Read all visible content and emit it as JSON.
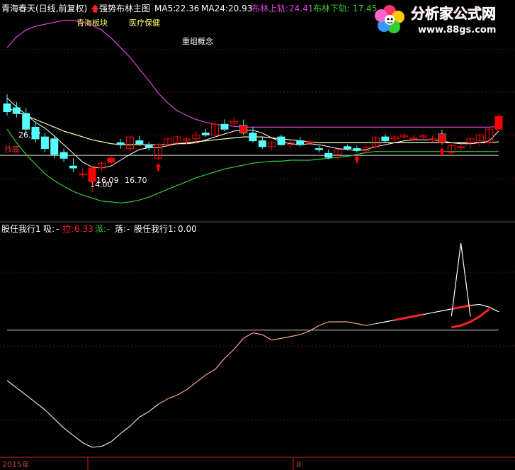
{
  "header": {
    "stock": "青海春天(日线,前复权)",
    "indicator": "强势布林主图",
    "ma5_label": "MA5:",
    "ma5_value": "22.36",
    "ma24_label": "MA24:",
    "ma24_value": "20.93",
    "upper_label": "布林上轨:",
    "upper_value": "24.41",
    "lower_label": "布林下轨:",
    "lower_value": "17.45"
  },
  "watermark": {
    "title": "分析家公式网",
    "url": "www.88gs.com"
  },
  "annotations": {
    "tag1": "青海板块",
    "tag2": "医疗保健",
    "tag3": "重组概念",
    "bottom_label": "抄底"
  },
  "price_labels": {
    "high": "26.97",
    "low": "14.00",
    "low_a": "16.09",
    "low_b": "16.70"
  },
  "lower_panel": {
    "name": "股任我行1",
    "xi_label": "吸:",
    "xi_value": "-",
    "la_label": "拉:",
    "la_value": "6.33",
    "pai_label": "派:",
    "pai_value": "-",
    "luo_label": "落:",
    "luo_value": "-",
    "value_label": "股任我行1:",
    "value": "0.00"
  },
  "axis": {
    "year": "2015年",
    "month": "8"
  },
  "colors": {
    "bg": "#000000",
    "up": "#ff0000",
    "down": "#55ffff",
    "upper": "#dd44dd",
    "lower": "#33cc33",
    "mid": "#ffffaa",
    "ma": "#ffffff",
    "arrow": "#ff0000",
    "la": "#ff2222"
  },
  "chart_data": {
    "type": "candlestick",
    "candles": [
      {
        "o": 25.2,
        "h": 26.2,
        "l": 24.0,
        "c": 24.4
      },
      {
        "o": 24.8,
        "h": 25.4,
        "l": 23.8,
        "c": 24.2
      },
      {
        "o": 24.2,
        "h": 24.8,
        "l": 22.0,
        "c": 22.6
      },
      {
        "o": 22.8,
        "h": 23.4,
        "l": 21.2,
        "c": 21.6
      },
      {
        "o": 21.8,
        "h": 22.2,
        "l": 20.2,
        "c": 20.6
      },
      {
        "o": 21.6,
        "h": 22.0,
        "l": 19.6,
        "c": 20.0
      },
      {
        "o": 20.2,
        "h": 20.6,
        "l": 19.2,
        "c": 19.6
      },
      {
        "o": 18.8,
        "h": 19.6,
        "l": 18.2,
        "c": 18.6
      },
      {
        "o": 18.0,
        "h": 18.6,
        "l": 17.6,
        "c": 18.0
      },
      {
        "o": 17.2,
        "h": 18.8,
        "l": 16.1,
        "c": 18.6
      },
      {
        "o": 18.6,
        "h": 19.3,
        "l": 18.2,
        "c": 19.1
      },
      {
        "o": 19.4,
        "h": 19.9,
        "l": 19.0,
        "c": 19.6
      },
      {
        "o": 21.2,
        "h": 21.6,
        "l": 20.6,
        "c": 21.0
      },
      {
        "o": 20.6,
        "h": 21.8,
        "l": 20.2,
        "c": 21.8
      },
      {
        "o": 21.4,
        "h": 21.9,
        "l": 20.9,
        "c": 21.1
      },
      {
        "o": 20.9,
        "h": 21.3,
        "l": 20.4,
        "c": 20.7
      },
      {
        "o": 19.6,
        "h": 21.2,
        "l": 19.4,
        "c": 21.0
      },
      {
        "o": 21.0,
        "h": 21.7,
        "l": 20.8,
        "c": 21.6
      },
      {
        "o": 21.2,
        "h": 21.9,
        "l": 20.9,
        "c": 21.8
      },
      {
        "o": 21.4,
        "h": 21.7,
        "l": 21.0,
        "c": 21.6
      },
      {
        "o": 21.6,
        "h": 22.4,
        "l": 21.1,
        "c": 22.0
      },
      {
        "o": 22.2,
        "h": 22.6,
        "l": 21.8,
        "c": 22.0
      },
      {
        "o": 22.0,
        "h": 23.2,
        "l": 21.8,
        "c": 23.1
      },
      {
        "o": 23.1,
        "h": 23.6,
        "l": 22.4,
        "c": 22.6
      },
      {
        "o": 23.2,
        "h": 23.8,
        "l": 22.8,
        "c": 23.4
      },
      {
        "o": 23.0,
        "h": 23.6,
        "l": 22.0,
        "c": 22.2
      },
      {
        "o": 22.2,
        "h": 22.8,
        "l": 21.2,
        "c": 21.4
      },
      {
        "o": 21.4,
        "h": 21.8,
        "l": 20.6,
        "c": 20.8
      },
      {
        "o": 20.8,
        "h": 21.4,
        "l": 20.4,
        "c": 21.2
      },
      {
        "o": 21.8,
        "h": 22.0,
        "l": 20.9,
        "c": 21.0
      },
      {
        "o": 21.0,
        "h": 21.4,
        "l": 20.6,
        "c": 21.2
      },
      {
        "o": 21.4,
        "h": 21.8,
        "l": 20.8,
        "c": 21.0
      },
      {
        "o": 21.2,
        "h": 21.5,
        "l": 20.9,
        "c": 21.3
      },
      {
        "o": 20.6,
        "h": 20.9,
        "l": 20.2,
        "c": 20.5
      },
      {
        "o": 20.1,
        "h": 20.5,
        "l": 19.5,
        "c": 19.7
      },
      {
        "o": 20.0,
        "h": 20.6,
        "l": 19.5,
        "c": 20.5
      },
      {
        "o": 20.8,
        "h": 21.0,
        "l": 20.4,
        "c": 20.6
      },
      {
        "o": 20.6,
        "h": 20.9,
        "l": 20.2,
        "c": 20.4
      },
      {
        "o": 20.4,
        "h": 20.9,
        "l": 20.2,
        "c": 20.7
      },
      {
        "o": 20.8,
        "h": 21.9,
        "l": 20.6,
        "c": 21.7
      },
      {
        "o": 21.8,
        "h": 22.1,
        "l": 21.2,
        "c": 21.4
      },
      {
        "o": 21.6,
        "h": 22.0,
        "l": 21.2,
        "c": 21.8
      },
      {
        "o": 21.9,
        "h": 22.2,
        "l": 21.6,
        "c": 21.9
      },
      {
        "o": 21.7,
        "h": 22.0,
        "l": 21.4,
        "c": 21.7
      },
      {
        "o": 21.8,
        "h": 22.1,
        "l": 21.6,
        "c": 21.9
      },
      {
        "o": 21.6,
        "h": 21.9,
        "l": 21.3,
        "c": 21.6
      },
      {
        "o": 22.1,
        "h": 22.5,
        "l": 21.0,
        "c": 21.2
      },
      {
        "o": 20.2,
        "h": 21.2,
        "l": 19.8,
        "c": 20.9
      },
      {
        "o": 20.7,
        "h": 21.1,
        "l": 20.4,
        "c": 20.8
      },
      {
        "o": 21.2,
        "h": 21.7,
        "l": 20.6,
        "c": 21.6
      },
      {
        "o": 21.4,
        "h": 22.1,
        "l": 20.8,
        "c": 22.0
      },
      {
        "o": 21.2,
        "h": 22.8,
        "l": 20.9,
        "c": 22.6
      },
      {
        "o": 22.6,
        "h": 24.2,
        "l": 22.4,
        "c": 23.9
      }
    ],
    "ma5": [
      25.8,
      24.9,
      24.1,
      23.3,
      22.7,
      21.9,
      21.0,
      20.1,
      19.2,
      18.7,
      18.6,
      18.8,
      19.4,
      20.0,
      20.5,
      20.7,
      20.7,
      20.9,
      21.1,
      21.1,
      21.2,
      21.5,
      21.8,
      22.1,
      22.4,
      22.5,
      22.5,
      22.2,
      21.7,
      21.3,
      21.1,
      21.0,
      21.1,
      21.0,
      20.8,
      20.6,
      20.5,
      20.4,
      20.5,
      20.8,
      21.0,
      21.2,
      21.4,
      21.5,
      21.5,
      21.5,
      21.4,
      21.2,
      21.1,
      21.1,
      21.2,
      21.4,
      22.4
    ],
    "mid": [
      24.8,
      24.4,
      24.0,
      23.6,
      23.2,
      22.8,
      22.4,
      22.1,
      21.8,
      21.5,
      21.3,
      21.1,
      21.0,
      21.0,
      21.0,
      21.0,
      21.0,
      21.0,
      21.1,
      21.2,
      21.3,
      21.4,
      21.5,
      21.6,
      21.7,
      21.8,
      21.8,
      21.8,
      21.7,
      21.6,
      21.5,
      21.4,
      21.3,
      21.2,
      21.2,
      21.2,
      21.2,
      21.2,
      21.2,
      21.2,
      21.2,
      21.2,
      21.2,
      21.2,
      21.2,
      21.2,
      21.2,
      21.2,
      21.2,
      21.2,
      21.2,
      21.2,
      21.3
    ],
    "upper": [
      31.0,
      32.1,
      32.8,
      33.2,
      33.4,
      33.6,
      33.8,
      33.8,
      33.6,
      33.3,
      32.8,
      32.0,
      31.0,
      30.0,
      28.8,
      27.6,
      26.3,
      25.3,
      24.5,
      24.0,
      23.6,
      23.3,
      23.1,
      23.0,
      22.9,
      22.8,
      22.8,
      22.8,
      22.8,
      22.8,
      22.8,
      22.8,
      22.8,
      22.8,
      22.8,
      22.8,
      22.8,
      22.8,
      22.8,
      22.8,
      22.8,
      22.8,
      22.8,
      22.8,
      22.8,
      22.8,
      22.8,
      22.8,
      22.8,
      22.8,
      22.8,
      22.8,
      22.9
    ],
    "lower": [
      22.6,
      21.2,
      20.0,
      19.0,
      18.0,
      17.3,
      16.7,
      16.2,
      15.8,
      15.5,
      15.2,
      15.1,
      15.0,
      15.1,
      15.3,
      15.6,
      16.0,
      16.4,
      16.8,
      17.2,
      17.6,
      17.9,
      18.2,
      18.5,
      18.7,
      18.9,
      19.1,
      19.2,
      19.3,
      19.3,
      19.4,
      19.4,
      19.4,
      19.5,
      19.6,
      19.7,
      19.8,
      20.0,
      20.2,
      20.3,
      20.3,
      20.3,
      20.3,
      20.3,
      20.3,
      20.3,
      20.3,
      20.3,
      20.3,
      20.3,
      20.3,
      20.3,
      20.3
    ],
    "support_level": 19.9,
    "signal": [
      20,
      28,
      36,
      44,
      52,
      62,
      72,
      80,
      88,
      93,
      92,
      87,
      78,
      70,
      60,
      54,
      46,
      40,
      36,
      30,
      22,
      14,
      8,
      -4,
      -14,
      -26,
      -32,
      -30,
      -24,
      -26,
      -28,
      -30,
      -34,
      -40,
      -44,
      -44,
      -44,
      -42,
      -40,
      -42,
      -44,
      -46,
      -48,
      -50,
      -52,
      -54,
      -56,
      -58,
      -60,
      -62,
      -63,
      -60,
      -55
    ],
    "signal_red_ranges": [
      [
        41,
        44
      ],
      [
        47,
        49
      ]
    ],
    "signal_spike": [
      {
        "i": 47,
        "v": -50
      },
      {
        "i": 48,
        "v": -130
      },
      {
        "i": 49,
        "v": -50
      }
    ],
    "signal_zero_line": -35,
    "signal_red_tail": [
      {
        "i": 47,
        "v": -38
      },
      {
        "i": 48,
        "v": -40
      },
      {
        "i": 49,
        "v": -44
      },
      {
        "i": 50,
        "v": -50
      },
      {
        "i": 51,
        "v": -58
      }
    ]
  }
}
